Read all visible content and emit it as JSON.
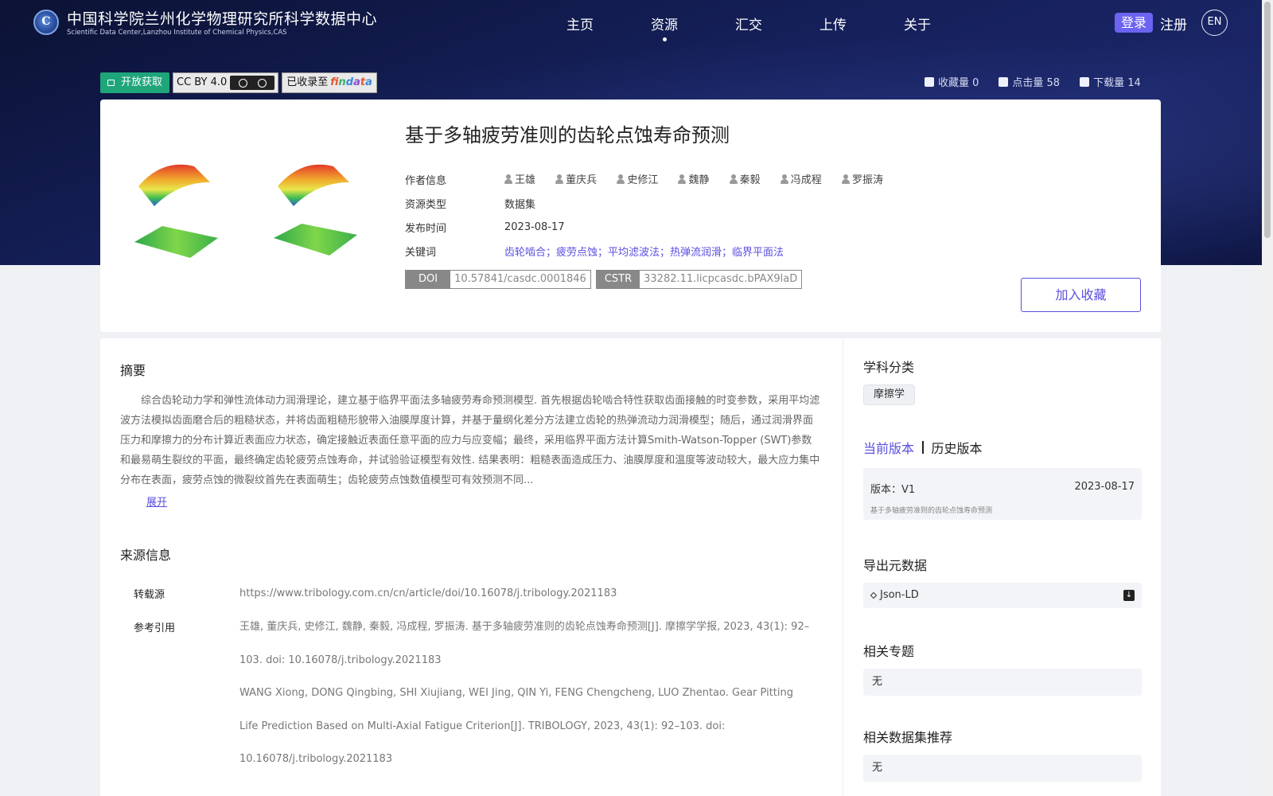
{
  "header": {
    "site_name_cn": "中国科学院兰州化学物理研究所科学数据中心",
    "site_name_en": "Scientific Data Center,Lanzhou Institute of Chemical Physics,CAS",
    "logo_glyph": "C",
    "nav": [
      "主页",
      "资源",
      "汇交",
      "上传",
      "关于"
    ],
    "active_nav": "资源",
    "login": "登录",
    "register": "注册",
    "lang": "EN"
  },
  "badges": {
    "open_access": "开放获取",
    "license": "CC BY 4.0",
    "indexed_prefix": "已收录至",
    "indexed_brand": [
      "f",
      "i",
      "n",
      "d",
      "a",
      "t",
      "a"
    ]
  },
  "stats": {
    "favorites": "收藏量 0",
    "views": "点击量 58",
    "downloads": "下载量 14"
  },
  "resource": {
    "title": "基于多轴疲劳准则的齿轮点蚀寿命预测",
    "labels": {
      "authors": "作者信息",
      "type": "资源类型",
      "date": "发布时间",
      "keywords": "关键词"
    },
    "authors": [
      "王雄",
      "董庆兵",
      "史修江",
      "魏静",
      "秦毅",
      "冯成程",
      "罗振涛"
    ],
    "type": "数据集",
    "date": "2023-08-17",
    "keywords": "齿轮啮合；疲劳点蚀；平均滤波法；热弹流润滑；临界平面法",
    "doi_label": "DOI",
    "doi": "10.57841/casdc.0001846",
    "cstr_label": "CSTR",
    "cstr": "33282.11.licpcasdc.bPAX9laD",
    "add_favorite": "加入收藏"
  },
  "abstract": {
    "title": "摘要",
    "text": "综合齿轮动力学和弹性流体动力润滑理论，建立基于临界平面法多轴疲劳寿命预测模型. 首先根据齿轮啮合特性获取齿面接触的时变参数，采用平均滤波方法模拟齿面磨合后的粗糙状态，并将齿面粗糙形貌带入油膜厚度计算，并基于量纲化差分方法建立齿轮的热弹流动力润滑模型；随后，通过润滑界面压力和摩擦力的分布计算近表面应力状态，确定接触近表面任意平面的应力与应变幅；最终，采用临界平面方法计算Smith-Watson-Topper (SWT)参数和最易萌生裂纹的平面，最终确定齿轮疲劳点蚀寿命，并试验验证模型有效性. 结果表明：粗糙表面造成压力、油膜厚度和温度等波动较大，最大应力集中分布在表面，疲劳点蚀的微裂纹首先在表面萌生；齿轮疲劳点蚀数值模型可有效预测不同...",
    "expand": "展开"
  },
  "source": {
    "title": "来源信息",
    "repost_label": "转载源",
    "repost_url": "https://www.tribology.com.cn/cn/article/doi/10.16078/j.tribology.2021183",
    "citation_label": "参考引用",
    "citation_cn": "王雄, 董庆兵, 史修江, 魏静, 秦毅, 冯成程, 罗振涛. 基于多轴疲劳准则的齿轮点蚀寿命预测[J]. 摩擦学学报, 2023, 43(1): 92–103. doi: 10.16078/j.tribology.2021183",
    "citation_en": "WANG Xiong, DONG Qingbing, SHI Xiujiang, WEI Jing, QIN Yi, FENG Chengcheng, LUO Zhentao. Gear Pitting Life Prediction Based on Multi-Axial Fatigue Criterion[J]. TRIBOLOGY, 2023, 43(1): 92–103. doi: 10.16078/j.tribology.2021183"
  },
  "sidebar": {
    "subject_title": "学科分类",
    "subject_tag": "摩擦学",
    "current_version": "当前版本",
    "history_version": "历史版本",
    "version_label": "版本：V1",
    "version_date": "2023-08-17",
    "version_name": "基于多轴疲劳准则的齿轮点蚀寿命预测",
    "export_title": "导出元数据",
    "export_format": "Json-LD",
    "topics_title": "相关专题",
    "topics_value": "无",
    "recommend_title": "相关数据集推荐",
    "recommend_value": "无"
  },
  "colors": {
    "accent": "#5a4fe0",
    "open_access_green": "#1fa57a",
    "hero_dark": "#0b1234"
  }
}
